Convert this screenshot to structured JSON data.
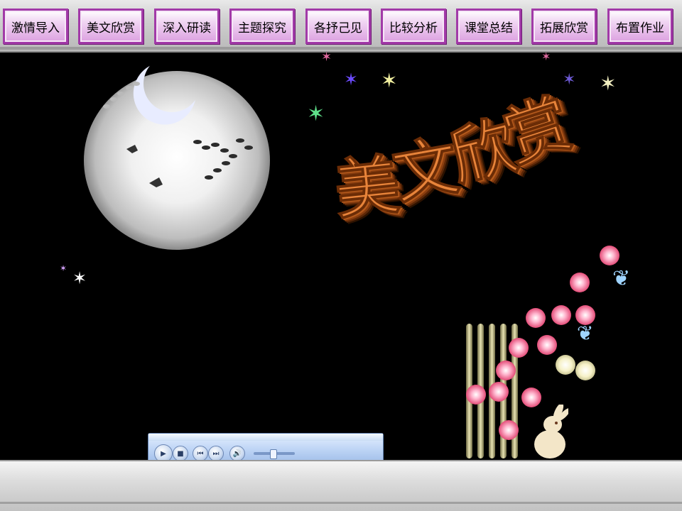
{
  "nav": {
    "items": [
      {
        "label": "激情导入"
      },
      {
        "label": "美文欣赏"
      },
      {
        "label": "深入研读"
      },
      {
        "label": "主题探究"
      },
      {
        "label": "各抒己见"
      },
      {
        "label": "比较分析"
      },
      {
        "label": "课堂总结"
      },
      {
        "label": "拓展欣赏"
      },
      {
        "label": "布置作业"
      }
    ],
    "button_color": "#dca1e0",
    "border_color": "#a23aa8"
  },
  "slide": {
    "title_chars": [
      "美",
      "文",
      "欣",
      "赏"
    ],
    "title_color": "#e8843a"
  },
  "media_player": {
    "volume_level": 0.45,
    "icons": [
      "play-icon",
      "stop-icon",
      "previous-icon",
      "next-icon",
      "volume-icon"
    ]
  }
}
